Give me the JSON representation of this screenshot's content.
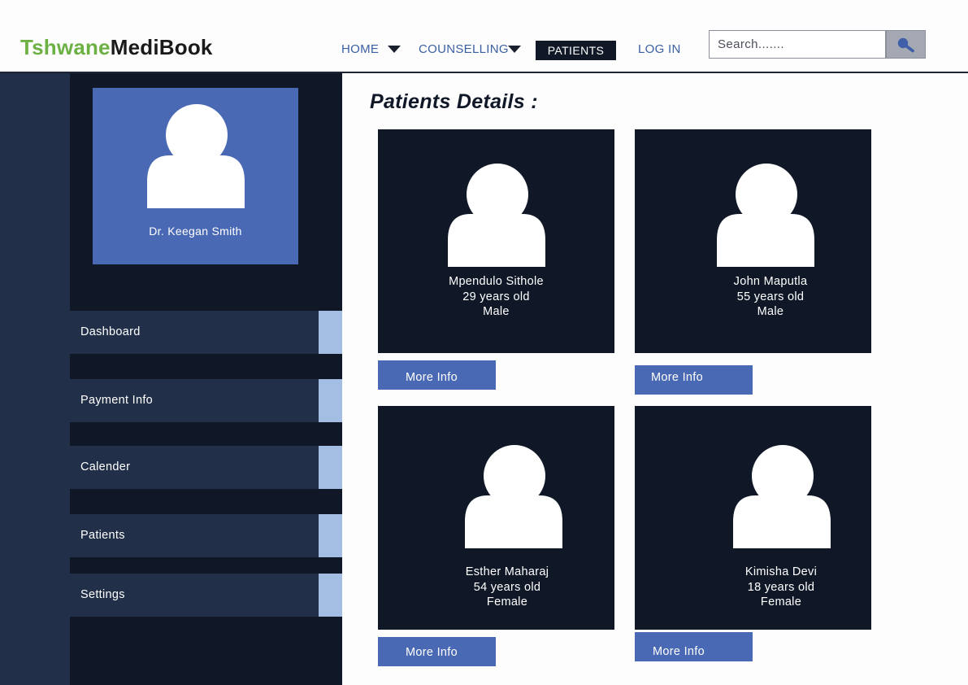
{
  "brand": {
    "part1": "Tshwane",
    "part2": "MediBook",
    "accent_color": "#6db144"
  },
  "nav": {
    "home": "HOME",
    "counselling": "COUNSELLING",
    "patients": "PATIENTS",
    "login": "LOG IN"
  },
  "search": {
    "placeholder": "Search......."
  },
  "profile": {
    "name": "Dr. Keegan Smith"
  },
  "sidebar": {
    "items": [
      {
        "label": "Dashboard"
      },
      {
        "label": "Payment Info"
      },
      {
        "label": "Calender"
      },
      {
        "label": "Patients"
      },
      {
        "label": "Settings"
      }
    ]
  },
  "main": {
    "title": "Patients Details :",
    "patients": [
      {
        "name": "Mpendulo Sithole",
        "age": "29 years old",
        "gender": "Male",
        "button": "More Info"
      },
      {
        "name": "John Maputla",
        "age": "55 years old",
        "gender": "Male",
        "button": "More Info"
      },
      {
        "name": "Esther Maharaj",
        "age": "54 years old",
        "gender": "Female",
        "button": "More Info"
      },
      {
        "name": "Kimisha Devi",
        "age": "18 years old",
        "gender": "Female",
        "button": "More Info"
      }
    ]
  },
  "colors": {
    "navy": "#101828",
    "panel": "#212f48",
    "blue": "#4a69b4",
    "light_blue": "#a3bde3"
  }
}
